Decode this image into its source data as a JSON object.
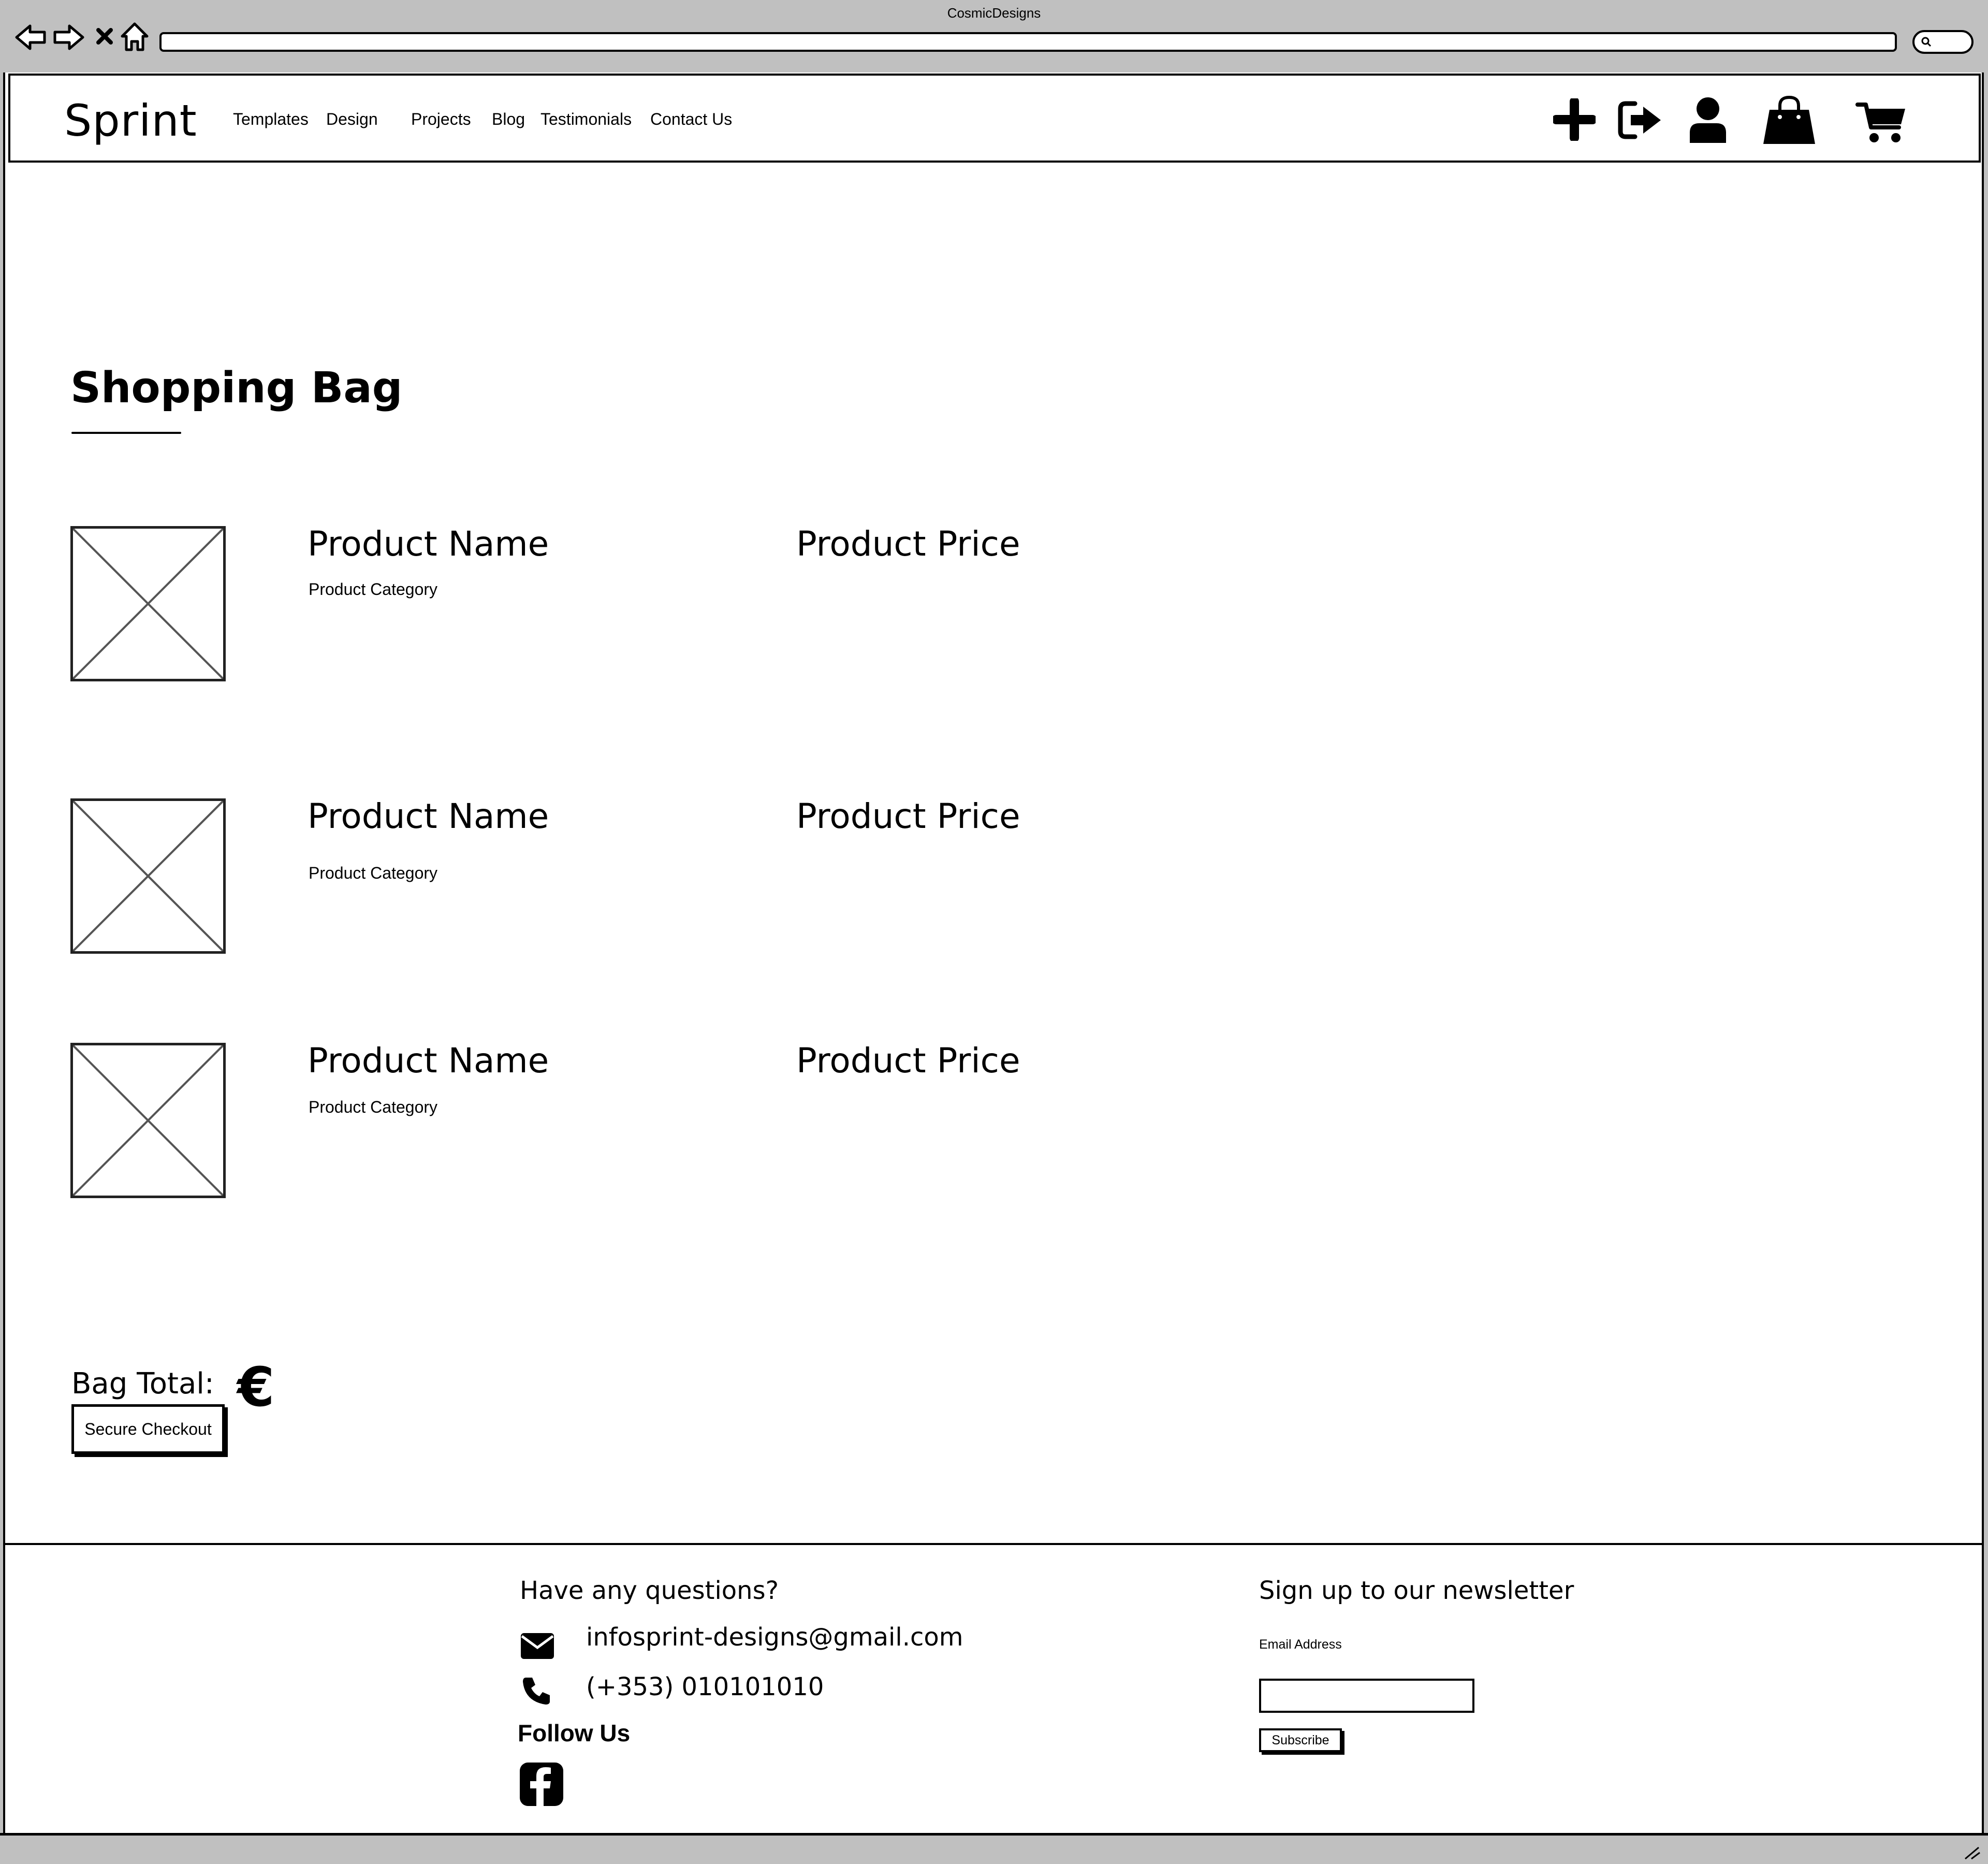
{
  "browser": {
    "window_title": "CosmicDesigns",
    "icons": [
      "back-arrow-icon",
      "forward-arrow-icon",
      "stop-icon",
      "home-icon",
      "search-icon"
    ]
  },
  "header": {
    "logo": "Sprint",
    "menu": [
      "Templates",
      "Design",
      "Projects",
      "Blog",
      "Testimonials",
      "Contact Us"
    ],
    "icons": [
      "plus-icon",
      "sign-in-icon",
      "user-icon",
      "shopping-bag-icon",
      "cart-icon"
    ]
  },
  "main": {
    "title": "Shopping Bag",
    "items": [
      {
        "name": "Product Name",
        "price": "Product Price",
        "category": "Product Category"
      },
      {
        "name": "Product Name",
        "price": "Product Price",
        "category": "Product Category"
      },
      {
        "name": "Product Name",
        "price": "Product Price",
        "category": "Product Category"
      }
    ],
    "bag_total_label": "Bag Total:",
    "currency_symbol": "€",
    "checkout_label": "Secure Checkout"
  },
  "footer": {
    "questions_heading": "Have any questions?",
    "email": "infosprint-designs@gmail.com",
    "phone": "(+353) 010101010",
    "follow_heading": "Follow Us",
    "newsletter_heading": "Sign up to our newsletter",
    "email_label": "Email Address",
    "subscribe_label": "Subscribe",
    "icons": [
      "envelope-icon",
      "phone-icon",
      "facebook-icon"
    ]
  }
}
